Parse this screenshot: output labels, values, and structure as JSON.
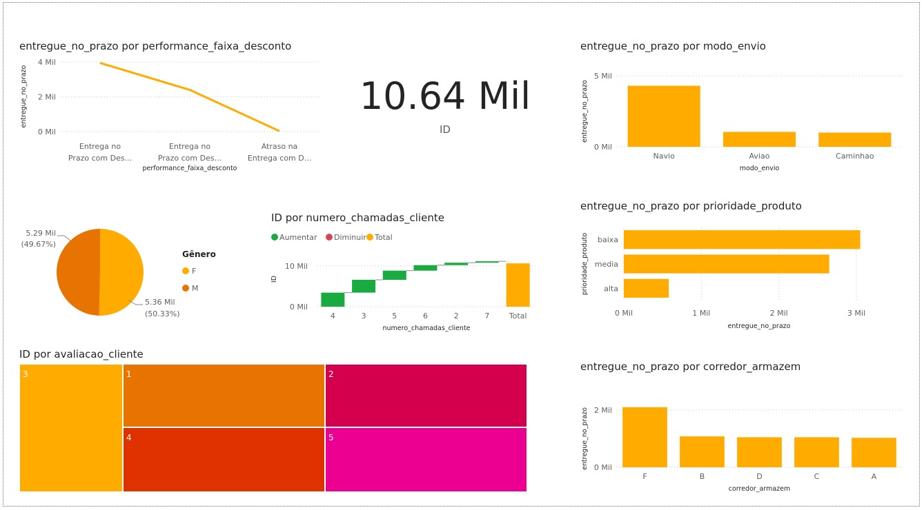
{
  "card": {
    "value": "10.64 Mil",
    "label": "ID"
  },
  "labels": {
    "k0": "0 Mil",
    "k1": "1 Mil",
    "k2": "2 Mil",
    "k3": "3 Mil",
    "k4": "4 Mil",
    "k5": "5 Mil",
    "k10": "10 Mil"
  },
  "colors": {
    "bar": "#FFAB00",
    "line": "#FFAB00",
    "pie_f": "#FFAB00",
    "pie_m": "#E87400",
    "increase": "#1AAB40",
    "decrease": "#D64554",
    "total": "#FFAB00",
    "tm_3": "#FFAB00",
    "tm_1": "#E87400",
    "tm_2": "#D4004D",
    "tm_4": "#E03100",
    "tm_5": "#EC0092"
  },
  "chart_data": [
    {
      "id": "line_faixa",
      "type": "line",
      "title": "entregue_no_prazo por performance_faixa_desconto",
      "xlabel": "performance_faixa_desconto",
      "ylabel": "entregue_no_prazo",
      "categories": [
        [
          "Entrega no",
          "Prazo com Des..."
        ],
        [
          "Entrega no",
          "Prazo com Des..."
        ],
        [
          "Atraso na",
          "Entrega com D..."
        ]
      ],
      "values": [
        3950,
        2400,
        30
      ],
      "ylim": [
        0,
        4000
      ],
      "yticks": [
        0,
        2000,
        4000
      ],
      "grid": true
    },
    {
      "id": "bar_envio",
      "type": "bar",
      "title": "entregue_no_prazo por modo_envio",
      "xlabel": "modo_envio",
      "ylabel": "entregue_no_prazo",
      "categories": [
        "Navio",
        "Aviao",
        "Caminhao"
      ],
      "values": [
        4300,
        1050,
        1000
      ],
      "ylim": [
        0,
        5000
      ],
      "yticks": [
        0,
        5000
      ],
      "grid": true
    },
    {
      "id": "pie_genero",
      "type": "pie",
      "legend_title": "Gênero",
      "legend_position": "right",
      "slices": [
        {
          "name": "F",
          "value": 5360,
          "label": "5.36 Mil",
          "pct": "(50.33%)"
        },
        {
          "name": "M",
          "value": 5290,
          "label": "5.29 Mil",
          "pct": "(49.67%)"
        }
      ]
    },
    {
      "id": "waterfall_chamadas",
      "type": "bar",
      "subtype": "waterfall",
      "title": "ID por numero_chamadas_cliente",
      "xlabel": "numero_chamadas_cliente",
      "ylabel": "ID",
      "legend": [
        "Aumentar",
        "Diminuir",
        "Total"
      ],
      "legend_position": "top-left",
      "categories": [
        "4",
        "3",
        "5",
        "6",
        "2",
        "7",
        "Total"
      ],
      "values": [
        3450,
        3150,
        2250,
        1350,
        600,
        350,
        10640
      ],
      "ylim": [
        0,
        11000
      ],
      "yticks": [
        0,
        10000
      ],
      "grid": true
    },
    {
      "id": "hbar_prioridade",
      "type": "bar",
      "orientation": "horizontal",
      "title": "entregue_no_prazo por prioridade_produto",
      "xlabel": "entregue_no_prazo",
      "ylabel": "prioridade_produto",
      "categories": [
        "baixa",
        "media",
        "alta"
      ],
      "values": [
        3050,
        2650,
        580
      ],
      "xlim": [
        0,
        3000
      ],
      "xticks": [
        0,
        1000,
        2000,
        3000
      ],
      "grid": true
    },
    {
      "id": "treemap_avaliacao",
      "type": "heatmap",
      "subtype": "treemap",
      "title": "ID por avaliacao_cliente",
      "categories": [
        "3",
        "1",
        "2",
        "4",
        "5"
      ]
    },
    {
      "id": "bar_corredor",
      "type": "bar",
      "title": "entregue_no_prazo por corredor_armazem",
      "xlabel": "corredor_armazem",
      "ylabel": "entregue_no_prazo",
      "categories": [
        "F",
        "B",
        "D",
        "C",
        "A"
      ],
      "values": [
        2100,
        1080,
        1050,
        1050,
        1030
      ],
      "ylim": [
        0,
        2000
      ],
      "yticks": [
        0,
        2000
      ],
      "grid": true
    }
  ]
}
